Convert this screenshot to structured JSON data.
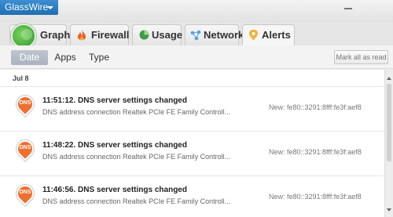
{
  "app": {
    "title": "GlassWire"
  },
  "tabs": [
    {
      "label": "Graph",
      "icon": "graph-icon",
      "active": false
    },
    {
      "label": "Firewall",
      "icon": "fire-icon",
      "active": false
    },
    {
      "label": "Usage",
      "icon": "usage-icon",
      "active": false
    },
    {
      "label": "Network",
      "icon": "network-icon",
      "active": false
    },
    {
      "label": "Alerts",
      "icon": "alert-icon",
      "active": true
    }
  ],
  "filters": {
    "date": "Date",
    "apps": "Apps",
    "type": "Type",
    "active": "Date"
  },
  "mark_all_read": "Mark all as read",
  "date_group": "Jul 8",
  "alerts": [
    {
      "badge": "DNS",
      "title": "11:51:12. DNS server settings changed",
      "detail": "DNS address connection Realtek PCIe FE Family Controll...",
      "new_value": "New: fe80::3291:8fff:fe3f:aef8"
    },
    {
      "badge": "DNS",
      "title": "11:48:22. DNS server settings changed",
      "detail": "DNS address connection Realtek PCIe FE Family Controll...",
      "new_value": "New: fe80::3291:8fff:fe3f:aef8"
    },
    {
      "badge": "DNS",
      "title": "11:46:56. DNS server settings changed",
      "detail": "DNS address connection Realtek PCIe FE Family Controll...",
      "new_value": "New: fe80::3291:8fff:fe3f:aef8"
    }
  ],
  "colors": {
    "app_button": "#2a7cc0",
    "dns_badge": "#ef6f2e",
    "active_filter": "#aeb6c2"
  }
}
